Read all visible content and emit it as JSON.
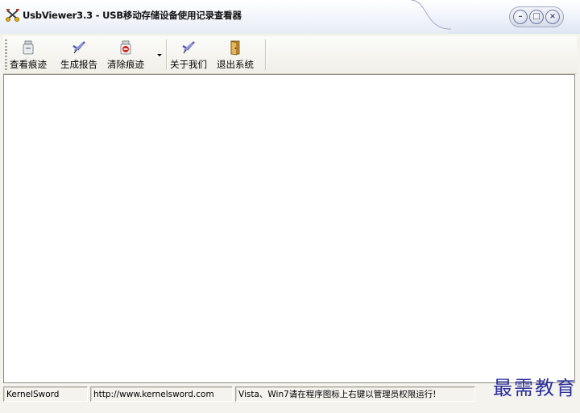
{
  "window": {
    "title": "UsbViewer3.3 - USB移动存储设备使用记录查看器",
    "controls": {
      "minimize": "–",
      "restore": "□",
      "close": "×"
    }
  },
  "toolbar": {
    "items": [
      {
        "label": "查看痕迹",
        "icon": "usb-drive-icon"
      },
      {
        "label": "生成报告",
        "icon": "report-pen-icon"
      },
      {
        "label": "清除痕迹",
        "icon": "usb-remove-icon",
        "has_dropdown": true
      },
      {
        "label": "关于我们",
        "icon": "info-pen-icon"
      },
      {
        "label": "退出系统",
        "icon": "exit-door-icon"
      }
    ]
  },
  "statusbar": {
    "panels": [
      "KernelSword",
      "http://www.kernelsword.com",
      "Vista、Win7请在程序图标上右键以管理员权限运行!"
    ]
  },
  "watermark": "最需教育",
  "colors": {
    "titlebar_accent": "#dfe6f3",
    "window_bg": "#f4f3ee",
    "watermark": "#2a2e9e"
  }
}
